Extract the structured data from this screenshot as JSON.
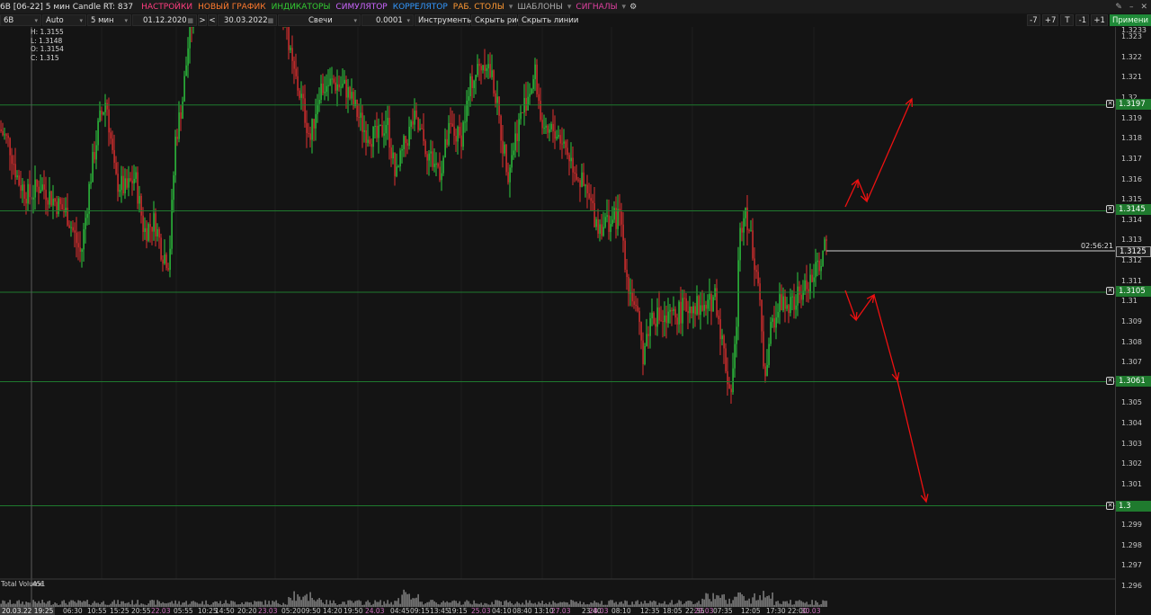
{
  "menubar": {
    "title": "6B [06-22] 5 мин Candle RT: 837",
    "items": [
      {
        "label": "НАСТРОЙКИ",
        "color": "#ff3d7f"
      },
      {
        "label": "НОВЫЙ ГРАФИК",
        "color": "#ff7a2e"
      },
      {
        "label": "ИНДИКАТОРЫ",
        "color": "#33cc33"
      },
      {
        "label": "СИМУЛЯТОР",
        "color": "#cc66ff"
      },
      {
        "label": "КОРРЕЛЯТОР",
        "color": "#3399ff"
      },
      {
        "label": "РАБ. СТОЛЫ",
        "color": "#ff9933"
      },
      {
        "label": "ШАБЛОНЫ",
        "color": "#aaaaaa"
      },
      {
        "label": "СИГНАЛЫ",
        "color": "#e040a0"
      }
    ]
  },
  "toolbar": {
    "symbol": "6B",
    "scale": "Auto",
    "timeframe": "5 мин",
    "date_from": "01.12.2020",
    "date_to": "30.03.2022",
    "nav_next": ">",
    "nav_prev": "<",
    "chart_type": "Свечи",
    "tick_size": "0.0001",
    "instruments": "Инструменты",
    "hide_drawings": "Скрыть рис.",
    "hide_lines": "Скрыть линии",
    "btn_minus7": "-7",
    "btn_plus7": "+7",
    "btn_t": "T",
    "btn_minus1": "-1",
    "btn_plus1": "+1",
    "apply": "Примени"
  },
  "ohlc": {
    "high": "H: 1.3155",
    "low": "L: 1.3148",
    "open": "O: 1.3154",
    "close": "C: 1.315"
  },
  "price_axis": {
    "ticks": [
      "1.3233",
      "1.323",
      "1.322",
      "1.321",
      "1.32",
      "1.319",
      "1.318",
      "1.317",
      "1.316",
      "1.315",
      "1.314",
      "1.313",
      "1.312",
      "1.311",
      "1.31",
      "1.309",
      "1.308",
      "1.307",
      "1.306",
      "1.305",
      "1.304",
      "1.303",
      "1.302",
      "1.301",
      "1.3",
      "1.299",
      "1.298",
      "1.297",
      "1.296"
    ],
    "levels": [
      "1.3197",
      "1.3145",
      "1.3105",
      "1.3061",
      "1.3"
    ],
    "current_price": "1.3125",
    "timer": "02:56:21",
    "level_color": "#1f7a2e",
    "up_color": "#2ecc40",
    "down_color": "#e03030",
    "arrow_color": "#ee1111"
  },
  "volume": {
    "label": "Total Volume",
    "value": "451"
  },
  "time_axis": {
    "cursor": "20.03.22 19:25",
    "labels": [
      {
        "text": "06:30",
        "day": false
      },
      {
        "text": "10:55",
        "day": false
      },
      {
        "text": "15:25",
        "day": false
      },
      {
        "text": "20:55",
        "day": false
      },
      {
        "text": "22.03",
        "day": true
      },
      {
        "text": "05:55",
        "day": false
      },
      {
        "text": "10:25",
        "day": false
      },
      {
        "text": "14:50",
        "day": false
      },
      {
        "text": "20:20",
        "day": false
      },
      {
        "text": "23.03",
        "day": true
      },
      {
        "text": "05:20",
        "day": false
      },
      {
        "text": "09:50",
        "day": false
      },
      {
        "text": "14:20",
        "day": false
      },
      {
        "text": "19:50",
        "day": false
      },
      {
        "text": "24.03",
        "day": true
      },
      {
        "text": "04:45",
        "day": false
      },
      {
        "text": "09:15",
        "day": false
      },
      {
        "text": "13:45",
        "day": false
      },
      {
        "text": "19:15",
        "day": false
      },
      {
        "text": "25.03",
        "day": true
      },
      {
        "text": "04:10",
        "day": false
      },
      {
        "text": "08:40",
        "day": false
      },
      {
        "text": "13:10",
        "day": false
      },
      {
        "text": "27.03",
        "day": true
      },
      {
        "text": "23:40",
        "day": false
      },
      {
        "text": "28.03",
        "day": true
      },
      {
        "text": "08:10",
        "day": false
      },
      {
        "text": "12:35",
        "day": false
      },
      {
        "text": "18:05",
        "day": false
      },
      {
        "text": "22:35",
        "day": false
      },
      {
        "text": "29.03",
        "day": true
      },
      {
        "text": "07:35",
        "day": false
      },
      {
        "text": "12:05",
        "day": false
      },
      {
        "text": "17:30",
        "day": false
      },
      {
        "text": "22:00",
        "day": false
      },
      {
        "text": "30.03",
        "day": true
      }
    ]
  }
}
